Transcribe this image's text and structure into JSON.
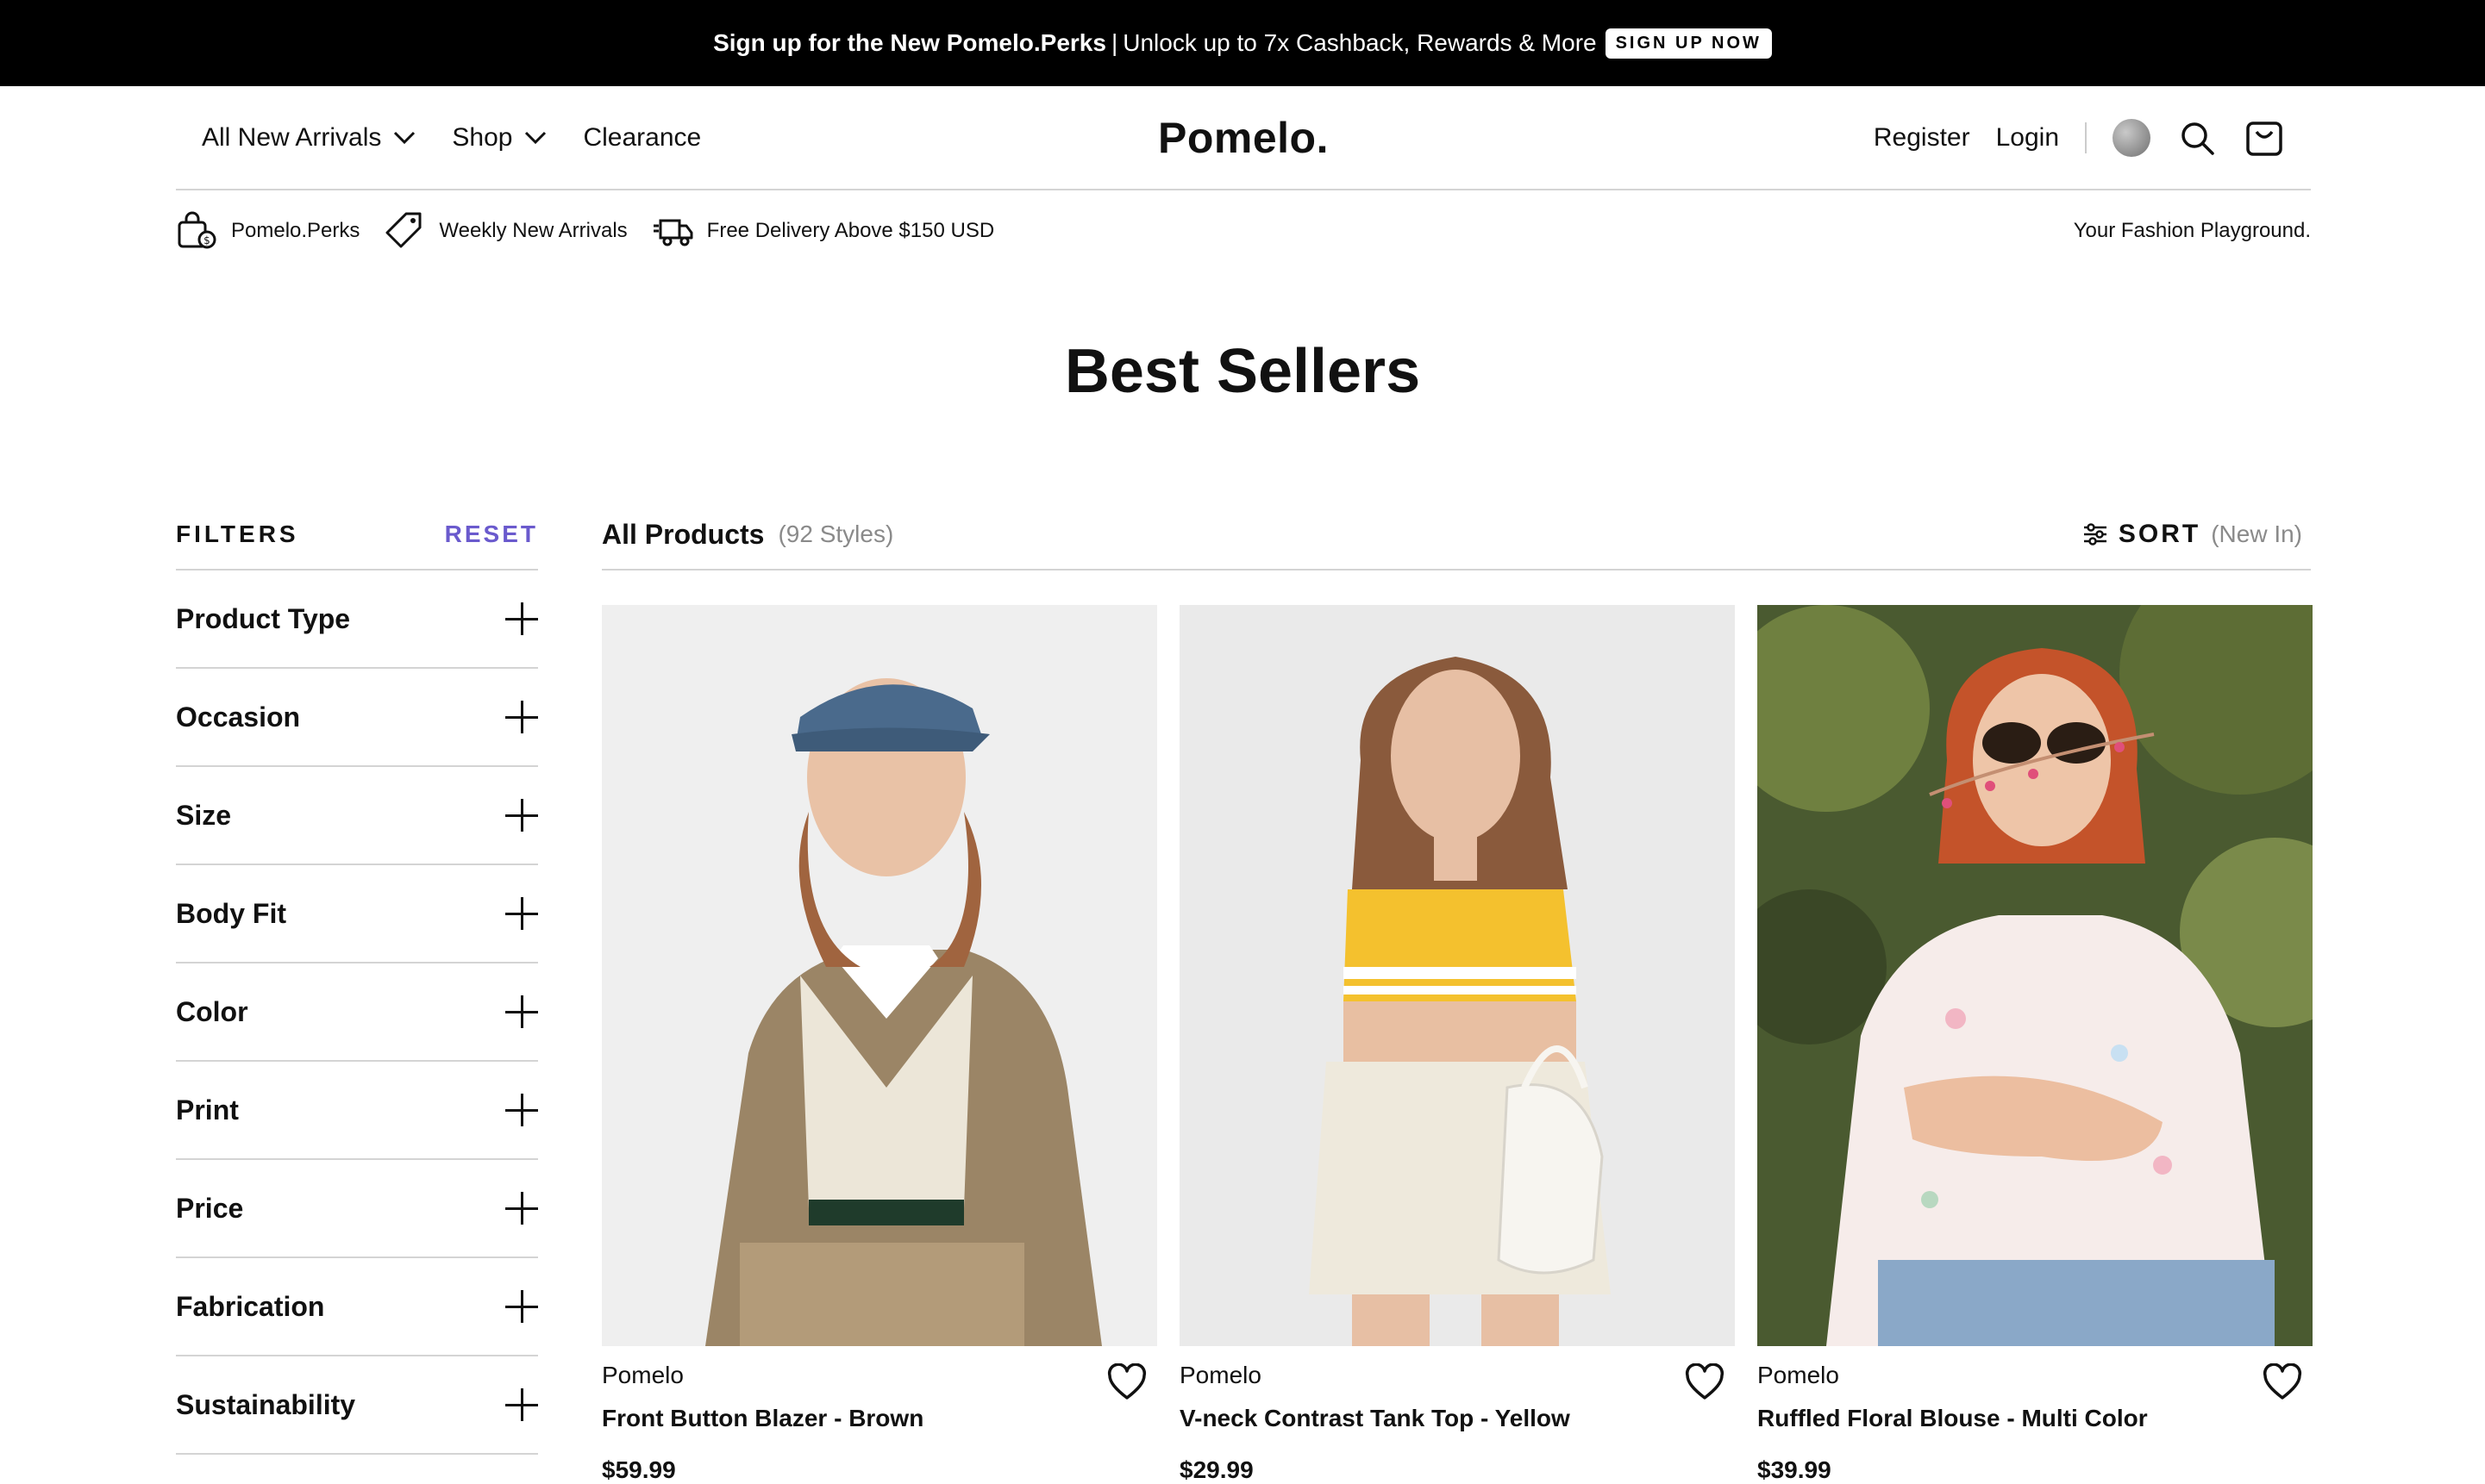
{
  "promo": {
    "bold_text": "Sign up for the New Pomelo.Perks",
    "separator": "|",
    "text": "Unlock up to 7x Cashback, Rewards & More",
    "cta": "SIGN UP NOW"
  },
  "nav": {
    "left": [
      {
        "label": "All New Arrivals",
        "dropdown": true
      },
      {
        "label": "Shop",
        "dropdown": true
      },
      {
        "label": "Clearance",
        "dropdown": false
      }
    ],
    "logo": "Pomelo.",
    "register": "Register",
    "login": "Login",
    "icons": [
      "globe-icon",
      "search-icon",
      "bag-icon"
    ]
  },
  "perks": {
    "items": [
      {
        "icon": "perks-bag-icon",
        "label": "Pomelo.Perks"
      },
      {
        "icon": "tag-icon",
        "label": "Weekly New Arrivals"
      },
      {
        "icon": "truck-icon",
        "label": "Free Delivery Above $150 USD"
      }
    ],
    "tagline": "Your Fashion Playground."
  },
  "page_title": "Best Sellers",
  "filters": {
    "title": "FILTERS",
    "reset": "RESET",
    "items": [
      "Product Type",
      "Occasion",
      "Size",
      "Body Fit",
      "Color",
      "Print",
      "Price",
      "Fabrication",
      "Sustainability"
    ]
  },
  "products": {
    "title": "All Products",
    "count": "(92 Styles)",
    "sort_label": "SORT",
    "sort_value": "(New In)",
    "items": [
      {
        "brand": "Pomelo",
        "name": "Front Button Blazer - Brown",
        "price": "$59.99"
      },
      {
        "brand": "Pomelo",
        "name": "V-neck Contrast Tank Top - Yellow",
        "price": "$29.99"
      },
      {
        "brand": "Pomelo",
        "name": "Ruffled Floral Blouse - Multi Color",
        "price": "$39.99"
      }
    ]
  },
  "colors": {
    "promo_bg": "#000000",
    "reset_accent": "#6a5acd",
    "muted": "#8a8a8a"
  }
}
